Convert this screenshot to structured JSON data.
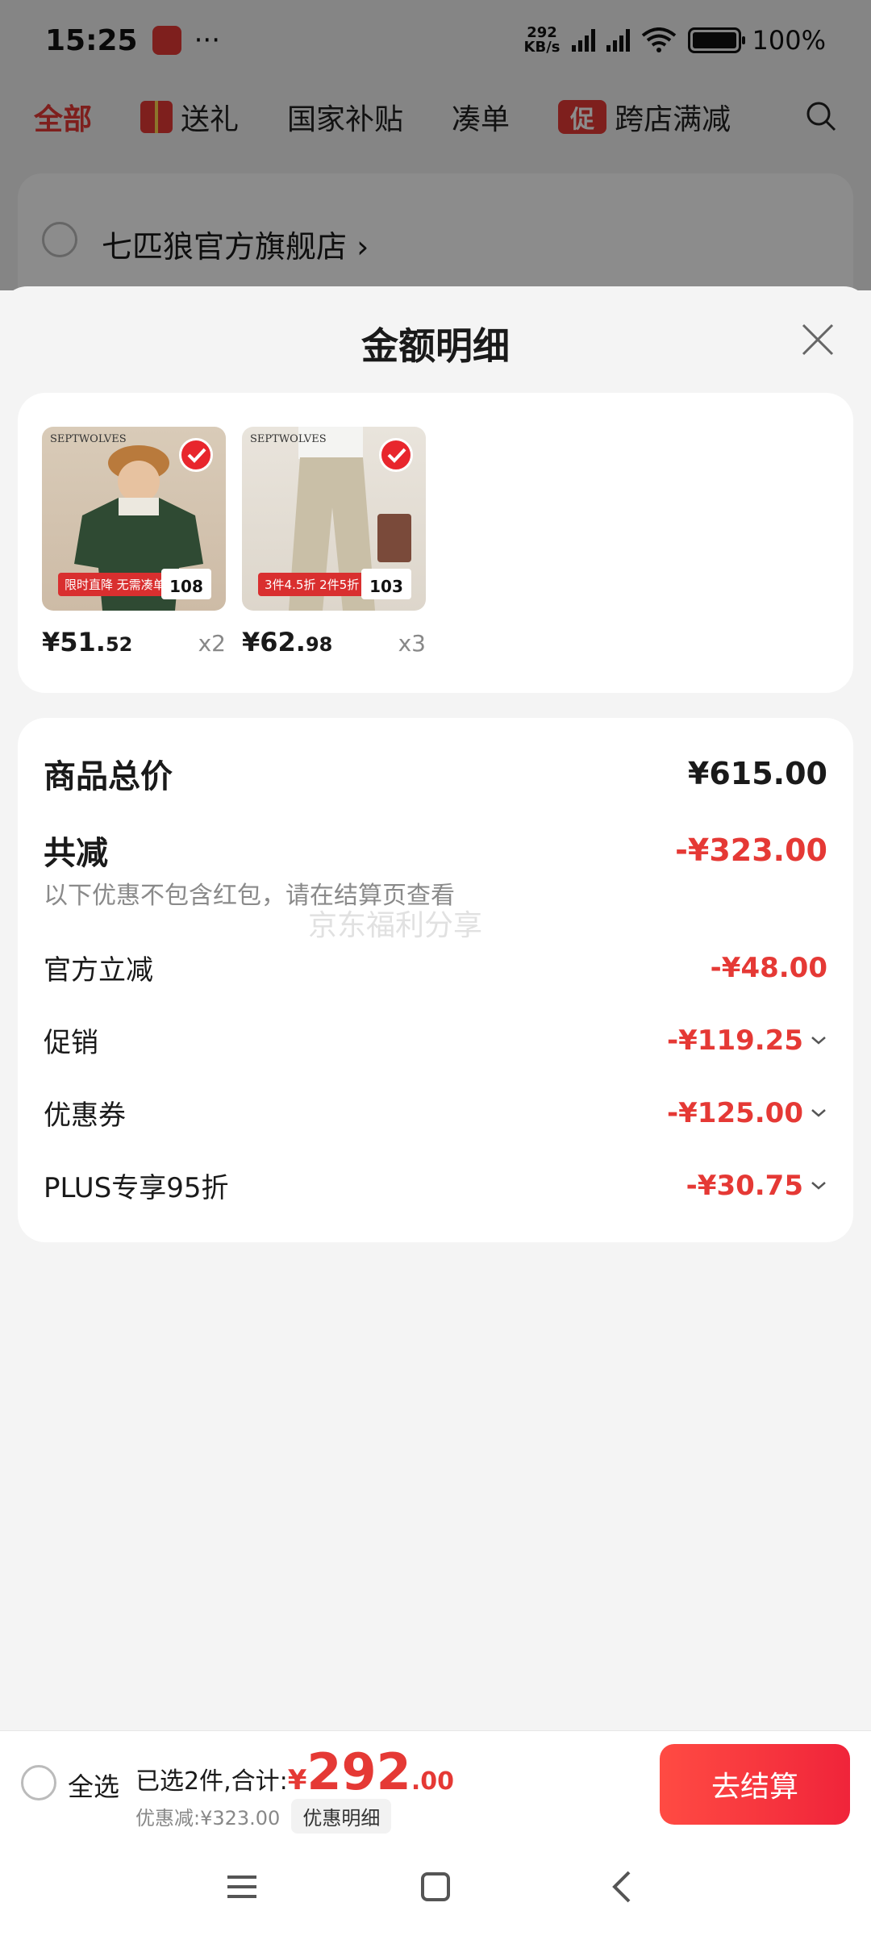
{
  "status_bar": {
    "time": "15:25",
    "dots": "···",
    "speed_top": "292",
    "speed_bottom": "KB/s",
    "battery": "100%"
  },
  "top_nav": {
    "items": [
      "全部",
      "送礼",
      "国家补贴",
      "凑单",
      "跨店满减"
    ],
    "promo_badge": "促"
  },
  "store": {
    "name": "七匹狼官方旗舰店 ›"
  },
  "sheet": {
    "title": "金额明细"
  },
  "goods": [
    {
      "brand": "SEPTWOLVES",
      "tag": "限时直降 无需凑单",
      "thumb_price": "108",
      "price_int": "¥51.",
      "price_dec": "52",
      "qty": "x2"
    },
    {
      "brand": "SEPTWOLVES",
      "tag": "3件4.5折 2件5折",
      "thumb_price": "103",
      "price_int": "¥62.",
      "price_dec": "98",
      "qty": "x3"
    }
  ],
  "details": {
    "total_label": "商品总价",
    "total_value": "¥615.00",
    "reduce_label": "共减",
    "reduce_value": "-¥323.00",
    "note": "以下优惠不包含红包，请在结算页查看",
    "watermark": "京东福利分享",
    "items": [
      {
        "label": "官方立减",
        "value": "-¥48.00"
      },
      {
        "label": "促销",
        "value": "-¥119.25"
      },
      {
        "label": "优惠券",
        "value": "-¥125.00"
      },
      {
        "label": "PLUS专享95折",
        "value": "-¥30.75"
      }
    ]
  },
  "bottom": {
    "select_all": "全选",
    "selected_text": "已选2件,合计:",
    "yen": "¥",
    "amount": "292",
    "decimal": ".00",
    "discount_text": "优惠减:¥323.00",
    "detail_button": "优惠明细",
    "checkout": "去结算"
  },
  "colors": {
    "accent": "#e53935",
    "checkout_start": "#ff4b43",
    "checkout_end": "#f0243a"
  }
}
